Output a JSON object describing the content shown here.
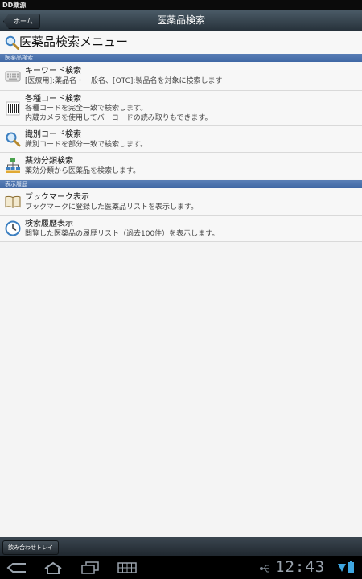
{
  "status": {
    "app_name": "DD薬源"
  },
  "titlebar": {
    "home_label": "ホーム",
    "title": "医薬品検索"
  },
  "menu": {
    "heading": "医薬品検索メニュー"
  },
  "sections": {
    "search": "医薬品検索",
    "history": "表示履歴"
  },
  "items": {
    "keyword": {
      "title": "キーワード検索",
      "desc": "[医療用]:薬品名・一般名、[OTC]:製品名を対象に検索します"
    },
    "code": {
      "title": "各種コード検索",
      "desc1": "各種コードを完全一致で検索します。",
      "desc2": "内蔵カメラを使用してバーコードの読み取りもできます。"
    },
    "ident": {
      "title": "識別コード検索",
      "desc": "識別コードを部分一致で検索します。"
    },
    "efficacy": {
      "title": "薬効分類検索",
      "desc": "薬効分類から医薬品を検索します。"
    },
    "bookmark": {
      "title": "ブックマーク表示",
      "desc": "ブックマークに登録した医薬品リストを表示します。"
    },
    "history": {
      "title": "検索履歴表示",
      "desc": "閲覧した医薬品の履歴リスト（過去100件）を表示します。"
    }
  },
  "tray": {
    "label": "飲み合わせトレイ"
  },
  "systembar": {
    "time": "12:43"
  }
}
